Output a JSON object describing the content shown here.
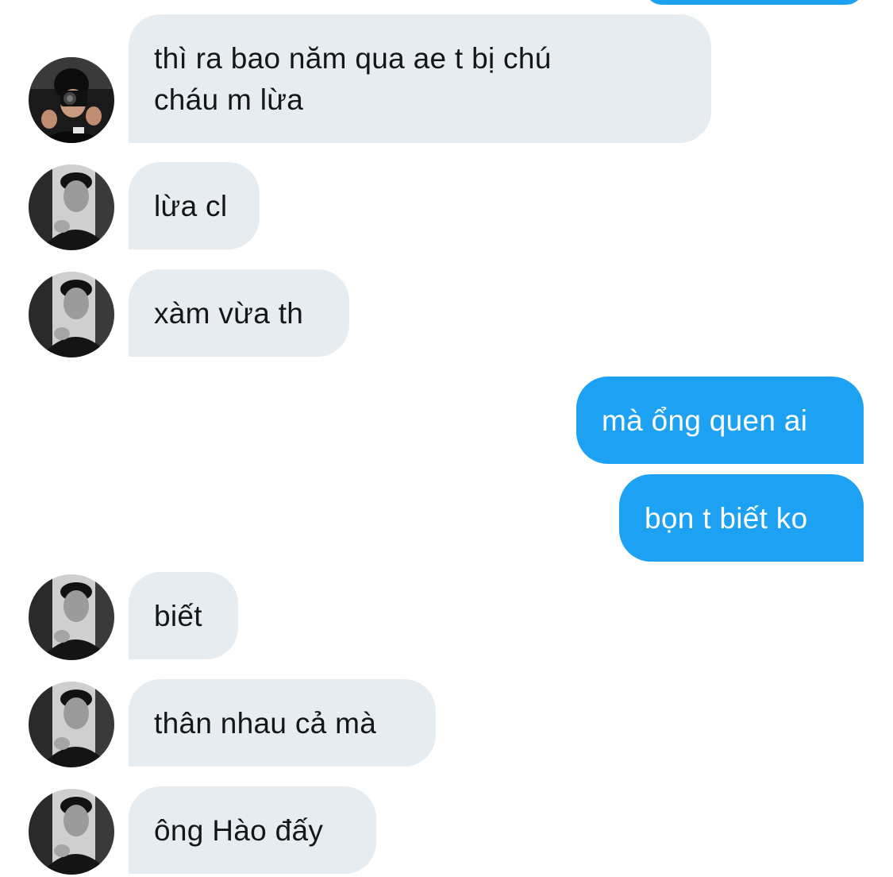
{
  "conversation": {
    "messages": [
      {
        "sender": "other",
        "avatar": "person-camera-avatar",
        "text_lines": [
          "thì ra bao năm qua ae t bị chú",
          "cháu m lừa"
        ]
      },
      {
        "sender": "other",
        "avatar": "person-bw-avatar",
        "text": "lừa cl"
      },
      {
        "sender": "other",
        "avatar": "person-bw-avatar",
        "text": "xàm vừa th"
      },
      {
        "sender": "me",
        "text": "mà ổng quen ai"
      },
      {
        "sender": "me",
        "text": "bọn t biết ko"
      },
      {
        "sender": "other",
        "avatar": "person-bw-avatar",
        "text": "biết"
      },
      {
        "sender": "other",
        "avatar": "person-bw-avatar",
        "text": "thân nhau cả mà"
      },
      {
        "sender": "other",
        "avatar": "person-bw-avatar",
        "text": "ông Hào đấy"
      }
    ]
  },
  "colors": {
    "incoming_bubble": "#e6ecf0",
    "outgoing_bubble": "#1da1f2",
    "incoming_text": "#14171a",
    "outgoing_text": "#ffffff"
  }
}
